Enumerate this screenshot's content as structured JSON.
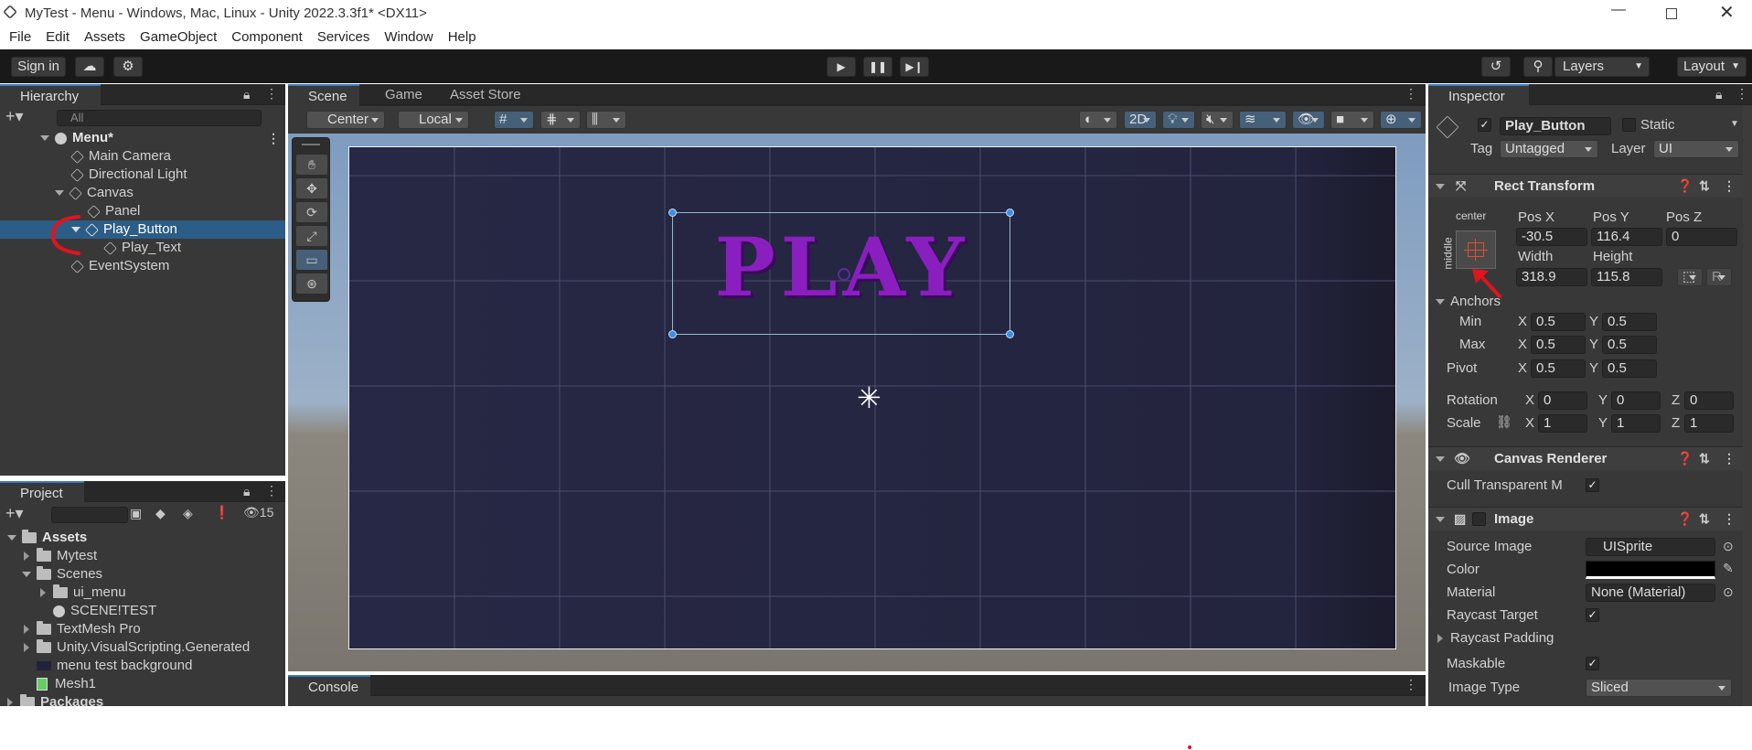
{
  "window": {
    "title": "MyTest - Menu - Windows, Mac, Linux - Unity 2022.3.3f1* <DX11>"
  },
  "menu": [
    "File",
    "Edit",
    "Assets",
    "GameObject",
    "Component",
    "Services",
    "Window",
    "Help"
  ],
  "toolbar": {
    "sign_in": "Sign in",
    "layers": "Layers",
    "layout": "Layout"
  },
  "hierarchy": {
    "tab": "Hierarchy",
    "search_placeholder": "All",
    "scene": "Menu*",
    "items": [
      "Main Camera",
      "Directional Light",
      "Canvas",
      "Panel",
      "Play_Button",
      "Play_Text",
      "EventSystem"
    ]
  },
  "scene": {
    "tabs": [
      "Scene",
      "Game",
      "Asset Store"
    ],
    "pivot": "Center",
    "space": "Local",
    "mode_2d": "2D",
    "play_text": "PLAY"
  },
  "project": {
    "tab": "Project",
    "hidden_count": "15",
    "root": "Assets",
    "items": [
      "Mytest",
      "Scenes",
      "ui_menu",
      "SCENE!TEST",
      "TextMesh Pro",
      "Unity.VisualScripting.Generated",
      "menu test background",
      "Mesh1"
    ],
    "packages": "Packages"
  },
  "console": {
    "tab": "Console"
  },
  "inspector": {
    "tab": "Inspector",
    "object_name": "Play_Button",
    "static_label": "Static",
    "tag_label": "Tag",
    "tag_value": "Untagged",
    "layer_label": "Layer",
    "layer_value": "UI",
    "rect": {
      "title": "Rect Transform",
      "anchor_h": "center",
      "anchor_v": "middle",
      "pos_x_label": "Pos X",
      "pos_y_label": "Pos Y",
      "pos_z_label": "Pos Z",
      "pos_x": "-30.5",
      "pos_y": "116.4",
      "pos_z": "0",
      "width_label": "Width",
      "height_label": "Height",
      "width": "318.9",
      "height": "115.8",
      "r_button": "R",
      "anchors": "Anchors",
      "min": "Min",
      "max": "Max",
      "pivot": "Pivot",
      "min_x": "0.5",
      "min_y": "0.5",
      "max_x": "0.5",
      "max_y": "0.5",
      "pivot_x": "0.5",
      "pivot_y": "0.5",
      "rotation": "Rotation",
      "scale": "Scale",
      "rot_x": "0",
      "rot_y": "0",
      "rot_z": "0",
      "scale_x": "1",
      "scale_y": "1",
      "scale_z": "1",
      "x": "X",
      "y": "Y",
      "z": "Z"
    },
    "canvas_renderer": {
      "title": "Canvas Renderer",
      "cull": "Cull Transparent Me"
    },
    "image": {
      "title": "Image",
      "source_label": "Source Image",
      "source_value": "UISprite",
      "color_label": "Color",
      "material_label": "Material",
      "material_value": "None (Material)",
      "raycast_target": "Raycast Target",
      "raycast_padding": "Raycast Padding",
      "maskable": "Maskable",
      "image_type": "Image Type",
      "image_type_value": "Sliced"
    }
  },
  "colors": {
    "selection": "#2c5d87",
    "accent": "#3a79bb",
    "play_purple": "#8a1fc0",
    "annotation_red": "#e0141e"
  }
}
